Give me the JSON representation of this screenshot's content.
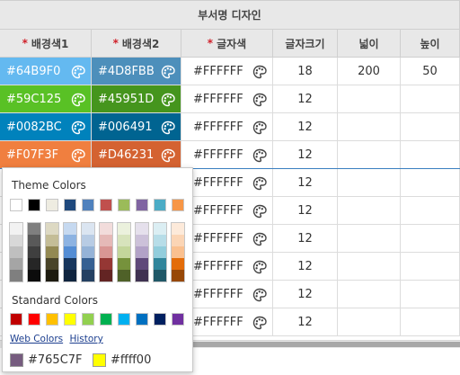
{
  "header": {
    "group_title": "부서명 디자인",
    "columns": [
      {
        "label": "배경색1",
        "required": "*"
      },
      {
        "label": "배경색2",
        "required": "*"
      },
      {
        "label": "글자색",
        "required": "*"
      },
      {
        "label": "글자크기",
        "required": ""
      },
      {
        "label": "넓이",
        "required": ""
      },
      {
        "label": "높이",
        "required": ""
      }
    ]
  },
  "rows": [
    {
      "bg1": "#64B9F0",
      "bg2": "#4D8FBB",
      "font_color": "#FFFFFF",
      "font_size": "18",
      "width": "200",
      "height": "50"
    },
    {
      "bg1": "#59C125",
      "bg2": "#45951D",
      "font_color": "#FFFFFF",
      "font_size": "12",
      "width": "",
      "height": ""
    },
    {
      "bg1": "#0082BC",
      "bg2": "#006491",
      "font_color": "#FFFFFF",
      "font_size": "12",
      "width": "",
      "height": ""
    },
    {
      "bg1": "#F07F3F",
      "bg2": "#D46231",
      "font_color": "#FFFFFF",
      "font_size": "12",
      "width": "",
      "height": ""
    },
    {
      "bg1": "",
      "bg2": "",
      "font_color": "#FFFFFF",
      "font_size": "12",
      "width": "",
      "height": ""
    },
    {
      "bg1": "",
      "bg2": "",
      "font_color": "#FFFFFF",
      "font_size": "12",
      "width": "",
      "height": ""
    },
    {
      "bg1": "",
      "bg2": "",
      "font_color": "#FFFFFF",
      "font_size": "12",
      "width": "",
      "height": ""
    },
    {
      "bg1": "",
      "bg2": "",
      "font_color": "#FFFFFF",
      "font_size": "12",
      "width": "",
      "height": ""
    },
    {
      "bg1": "",
      "bg2": "",
      "font_color": "#FFFFFF",
      "font_size": "12",
      "width": "",
      "height": ""
    },
    {
      "bg1": "",
      "bg2": "",
      "font_color": "#FFFFFF",
      "font_size": "12",
      "width": "",
      "height": ""
    }
  ],
  "picker": {
    "theme_title": "Theme Colors",
    "standard_title": "Standard Colors",
    "web_colors_link": "Web Colors",
    "history_link": "History",
    "theme_base": [
      "#FFFFFF",
      "#000000",
      "#EEECE1",
      "#1F497D",
      "#4F81BD",
      "#C0504D",
      "#9BBB59",
      "#8064A2",
      "#4BACC6",
      "#F79646"
    ],
    "theme_shades": [
      [
        "#F2F2F2",
        "#D8D8D8",
        "#BFBFBF",
        "#A5A5A5",
        "#7F7F7F"
      ],
      [
        "#7F7F7F",
        "#595959",
        "#3F3F3F",
        "#262626",
        "#0C0C0C"
      ],
      [
        "#DDD9C3",
        "#C4BD97",
        "#938953",
        "#494429",
        "#1D1B10"
      ],
      [
        "#C6D9F0",
        "#8DB3E2",
        "#548DD4",
        "#17365D",
        "#0F243E"
      ],
      [
        "#DBE5F1",
        "#B8CCE4",
        "#95B3D7",
        "#366092",
        "#244061"
      ],
      [
        "#F2DCDB",
        "#E5B9B7",
        "#D99694",
        "#953734",
        "#632423"
      ],
      [
        "#EBF1DD",
        "#D7E3BC",
        "#C3D69B",
        "#76923C",
        "#4F6128"
      ],
      [
        "#E5E0EC",
        "#CCC1D9",
        "#B2A2C7",
        "#5F497A",
        "#3F3151"
      ],
      [
        "#DBEEF3",
        "#B7DDE8",
        "#92CDDC",
        "#31859B",
        "#205867"
      ],
      [
        "#FDEADA",
        "#FBD5B5",
        "#FAC08F",
        "#E36C09",
        "#974806"
      ]
    ],
    "standard": [
      "#C00000",
      "#FF0000",
      "#FFC000",
      "#FFFF00",
      "#92D050",
      "#00B050",
      "#00B0F0",
      "#0070C0",
      "#002060",
      "#7030A0"
    ],
    "recent": [
      {
        "hex": "#765C7F",
        "label": "#765C7F"
      },
      {
        "hex": "#FFFF00",
        "label": "#ffff00"
      }
    ]
  }
}
